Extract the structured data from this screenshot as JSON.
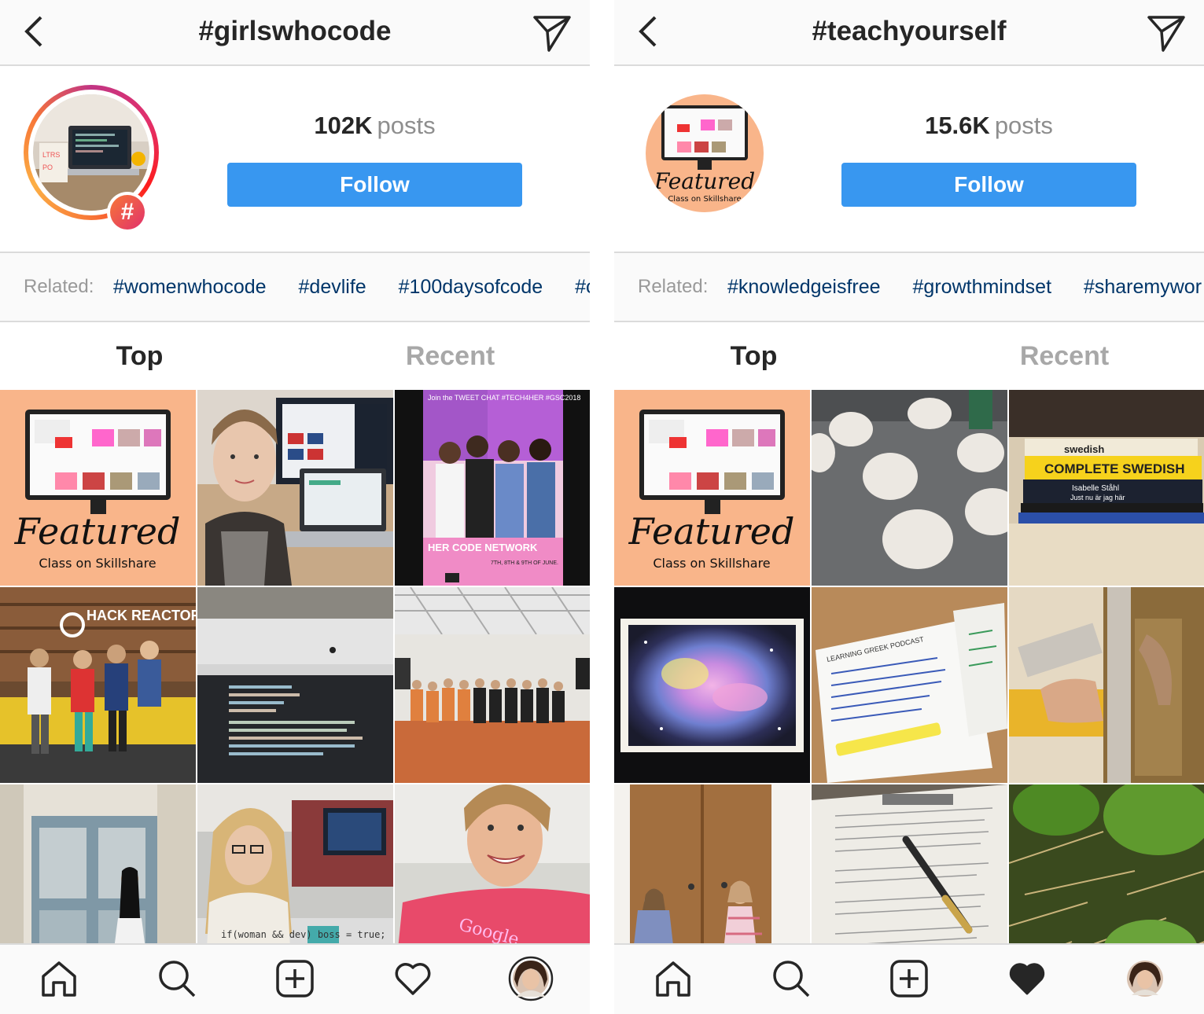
{
  "screens": [
    {
      "id": "left",
      "hashtag": "#girlswhocode",
      "posts_count": "102K",
      "posts_label": "posts",
      "follow_label": "Follow",
      "related_label": "Related:",
      "related_tags": [
        "#womenwhocode",
        "#devlife",
        "#100daysofcode",
        "#c"
      ],
      "tabs": [
        "Top",
        "Recent"
      ],
      "hash_badge": "#",
      "grid_text": {
        "featured": "Featured",
        "class_on": "Class on Skillshare",
        "tweet_chat": "Join the TWEET CHAT #TECH4HER #GSC2018",
        "her_code": "HER CODE NETWORK",
        "tech4her_dates": "7TH, 8TH & 9TH OF JUNE.",
        "hack_reactor": "HACK REACTOR",
        "google": "Google",
        "tshirt": "if(woman && dev) boss = true;"
      },
      "bottom_nav": [
        "home-icon",
        "search-icon",
        "new-post-icon",
        "heart-outline-icon",
        "profile-avatar-icon"
      ]
    },
    {
      "id": "right",
      "hashtag": "#teachyourself",
      "posts_count": "15.6K",
      "posts_label": "posts",
      "follow_label": "Follow",
      "related_label": "Related:",
      "related_tags": [
        "#knowledgeisfree",
        "#growthmindset",
        "#sharemywor"
      ],
      "tabs": [
        "Top",
        "Recent"
      ],
      "grid_text": {
        "featured": "Featured",
        "class_on": "Class on Skillshare",
        "book1": "swedish",
        "book2": "COMPLETE SWEDISH",
        "book3": "Isabelle Ståhl",
        "book3b": "Just nu är jag här",
        "notes_title": "LEARNING GREEK PODCAST"
      },
      "bottom_nav": [
        "home-icon",
        "search-icon",
        "new-post-icon",
        "heart-filled-icon",
        "profile-avatar-icon"
      ]
    }
  ],
  "colors": {
    "follow_blue": "#3897f0",
    "related_link": "#003569",
    "muted": "#8e8e8e",
    "featured_peach": "#f9b58a"
  }
}
